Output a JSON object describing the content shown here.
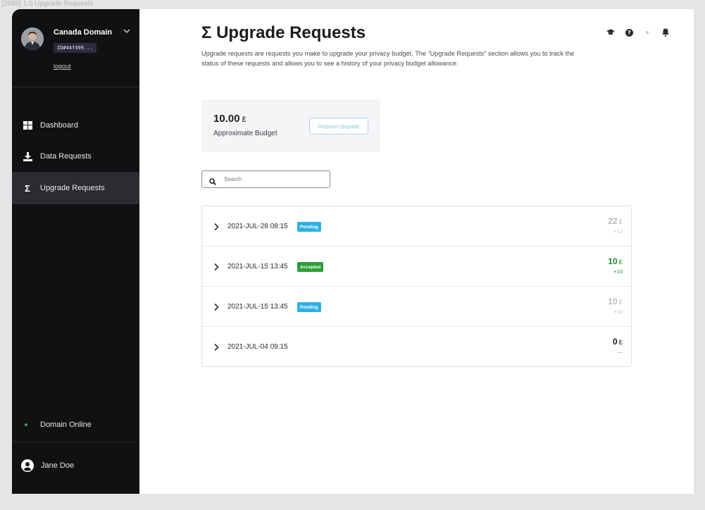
{
  "frame_label": "[2689] 1.0 Upgrade Requests",
  "sidebar": {
    "domain_name": "Canada Domain",
    "domain_id": "ID#44f499...",
    "logout_label": "logout",
    "nav": [
      {
        "label": "Dashboard",
        "icon": "dashboard-grid-icon"
      },
      {
        "label": "Data Requests",
        "icon": "download-icon"
      },
      {
        "label": "Upgrade Requests",
        "icon": "sigma-icon",
        "active": true
      }
    ],
    "status_label": "Domain Online",
    "user_name": "Jane Doe"
  },
  "header": {
    "title": "Σ Upgrade Requests",
    "description": "Upgrade requests are requests you make to upgrade your privacy budget. The “Upgrade Requests” section allows you to track the status of these requests and allows you to see a history of your privacy budget allowance.",
    "icons": [
      "graduation-cap-icon",
      "help-circle-icon",
      "dot-icon",
      "bell-icon"
    ]
  },
  "budget": {
    "value": "10.00",
    "unit": "ε",
    "label": "Approximate Budget",
    "button_label": "Request Upgrade"
  },
  "search": {
    "placeholder": "Search"
  },
  "requests": [
    {
      "date": "2021-JUL-28 08:15",
      "status": "Pending",
      "amount": "22",
      "unit": "ε",
      "delta": "+12",
      "color": "#b9b9bf",
      "badge_color": "#2fb0e3"
    },
    {
      "date": "2021-JUL-15 13:45",
      "status": "Accepted",
      "amount": "10",
      "unit": "ε",
      "delta": "+10",
      "color": "#258a2f",
      "badge_color": "#2e9e3a"
    },
    {
      "date": "2021-JUL-15 13:45",
      "status": "Pending",
      "amount": "10",
      "unit": "ε",
      "delta": "+10",
      "color": "#b9b9bf",
      "badge_color": "#2fb0e3"
    },
    {
      "date": "2021-JUL-04 09:15",
      "status": "",
      "amount": "0",
      "unit": "ε",
      "delta": "—",
      "color": "#1c1c1f",
      "badge_color": ""
    }
  ],
  "colors": {
    "sidebar_bg": "#111113",
    "accent_online": "#28b33c",
    "pending": "#2fb0e3",
    "accepted": "#2e9e3a"
  }
}
